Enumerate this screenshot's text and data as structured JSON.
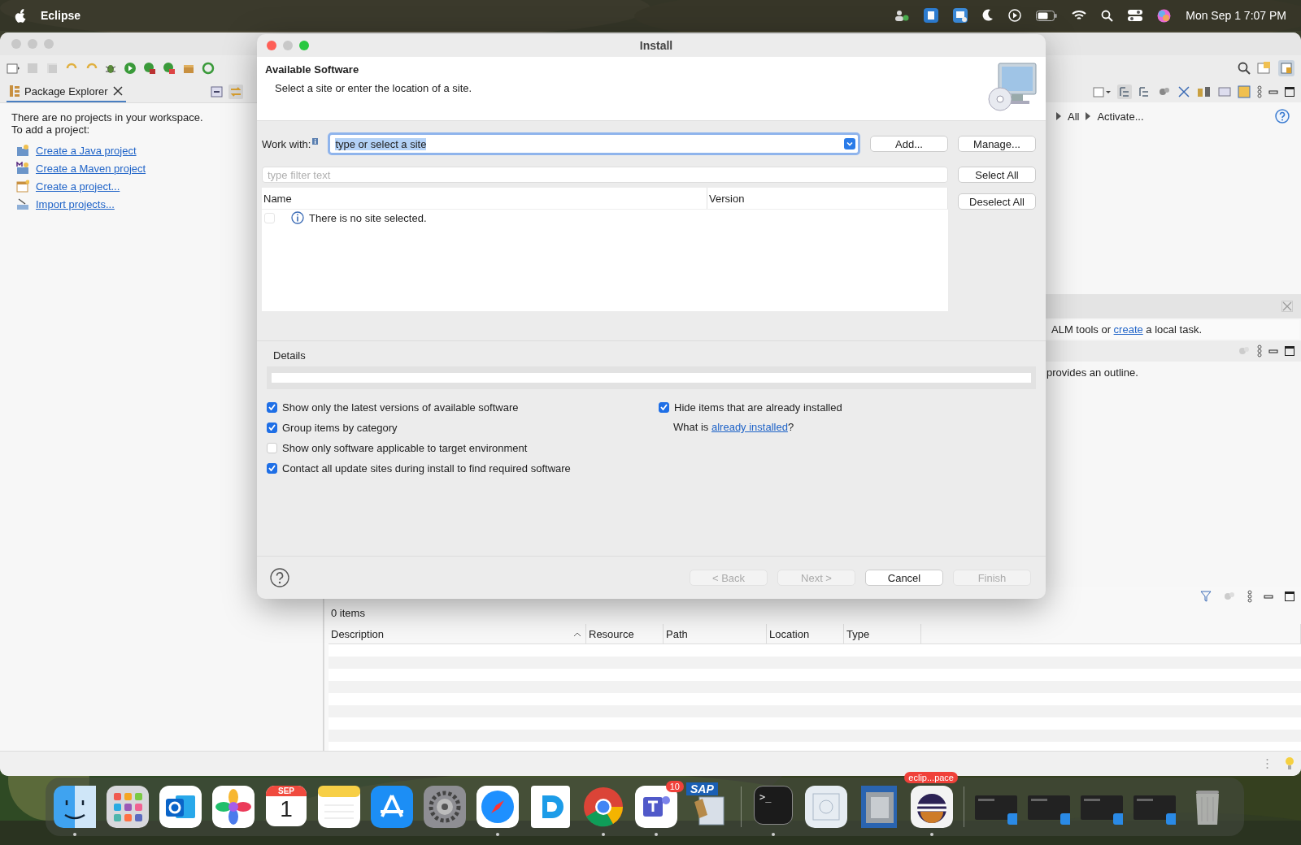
{
  "menu_bar": {
    "app_name": "Eclipse",
    "clock": "Mon Sep 1  7:07 PM"
  },
  "eclipse": {
    "package_explorer": {
      "tab": "Package Explorer",
      "message": [
        "There are no projects in your workspace.",
        "To add a project:"
      ],
      "links": [
        {
          "kind": "java",
          "label": "Create a Java project"
        },
        {
          "kind": "maven",
          "label": "Create a Maven project"
        },
        {
          "kind": "project",
          "label": "Create a project..."
        },
        {
          "kind": "import",
          "label": "Import projects..."
        }
      ]
    },
    "task_filters": [
      "All",
      "Activate..."
    ],
    "task_notice": {
      "before": "ALM tools or ",
      "link": "create",
      "after": " a local task."
    },
    "outline_notice": "provides an outline.",
    "problems": {
      "count": "0 items",
      "columns": [
        "Description",
        "Resource",
        "Path",
        "Location",
        "Type"
      ]
    }
  },
  "dialog": {
    "title": "Install",
    "heading": "Available Software",
    "subtitle": "Select a site or enter the location of a site.",
    "work_with_label": "Work with:",
    "site_value": "type or select a site",
    "site_buttons": [
      "Add...",
      "Manage..."
    ],
    "filter_placeholder": "type filter text",
    "list_buttons": [
      "Select All",
      "Deselect All"
    ],
    "columns": [
      "Name",
      "Version"
    ],
    "site_rows": [
      {
        "label": "There is no site selected.",
        "checked": false
      }
    ],
    "details_label": "Details",
    "options": [
      {
        "label": "Show only the latest versions of available software",
        "checked": true
      },
      {
        "label": "Group items by category",
        "checked": true
      },
      {
        "label": "Show only software applicable to target environment",
        "checked": false
      },
      {
        "label": "Contact all update sites during install to find required software",
        "checked": true
      }
    ],
    "hide_installed": {
      "label": "Hide items that are already installed",
      "checked": true
    },
    "installed_question": {
      "before": "What is ",
      "link": "already installed",
      "after": "?"
    },
    "nav_buttons": [
      {
        "label": "< Back",
        "disabled": true
      },
      {
        "label": "Next >",
        "disabled": true
      },
      {
        "label": "Cancel",
        "disabled": false
      },
      {
        "label": "Finish",
        "disabled": true
      }
    ]
  },
  "dock": {
    "items": [
      {
        "kind": "finder",
        "running": true
      },
      {
        "kind": "launchpad",
        "running": false
      },
      {
        "kind": "outlook",
        "running": false
      },
      {
        "kind": "photos",
        "running": false
      },
      {
        "kind": "calendar",
        "running": false,
        "month": "SEP",
        "day": "1"
      },
      {
        "kind": "notes",
        "running": false
      },
      {
        "kind": "appstore",
        "running": false
      },
      {
        "kind": "settings",
        "running": false
      },
      {
        "kind": "safari",
        "running": true
      },
      {
        "kind": "blueapp",
        "running": false
      },
      {
        "kind": "chrome",
        "running": true
      },
      {
        "kind": "teams",
        "running": true,
        "badge": "10"
      },
      {
        "kind": "sap",
        "running": false,
        "label": "SAP"
      },
      {
        "kind": "separator"
      },
      {
        "kind": "terminal",
        "running": true,
        "prompt": ">_"
      },
      {
        "kind": "preview",
        "running": false
      },
      {
        "kind": "chip",
        "running": false
      },
      {
        "kind": "eclipse",
        "running": true,
        "badge": "eclip...pace"
      },
      {
        "kind": "separator"
      },
      {
        "kind": "window",
        "running": false
      },
      {
        "kind": "window",
        "running": false
      },
      {
        "kind": "window",
        "running": false
      },
      {
        "kind": "window",
        "running": false
      },
      {
        "kind": "trash",
        "running": false
      }
    ]
  }
}
